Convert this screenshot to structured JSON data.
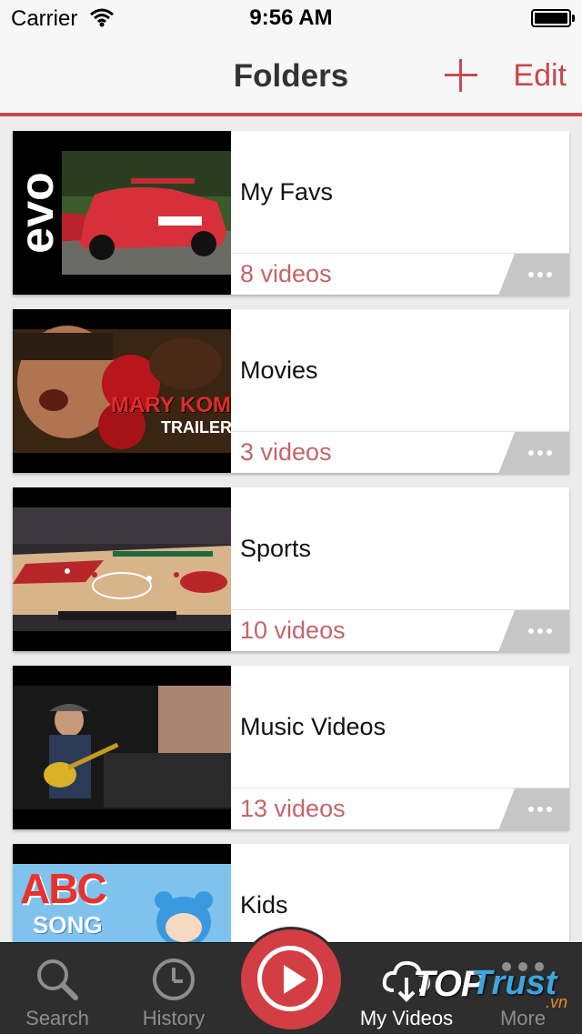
{
  "status_bar": {
    "carrier": "Carrier",
    "time": "9:56 AM"
  },
  "nav": {
    "title": "Folders",
    "edit_label": "Edit"
  },
  "folders": [
    {
      "name": "My Favs",
      "count": "8 videos",
      "thumb_text": "evo",
      "icon": "car-thumbnail"
    },
    {
      "name": "Movies",
      "count": "3 videos",
      "thumb_text": "MARY KOM",
      "thumb_subtext": "TRAILER",
      "icon": "boxer-thumbnail"
    },
    {
      "name": "Sports",
      "count": "10 videos",
      "icon": "basketball-court-thumbnail"
    },
    {
      "name": "Music Videos",
      "count": "13 videos",
      "icon": "guitarist-thumbnail"
    },
    {
      "name": "Kids",
      "count": "",
      "thumb_text": "ABC",
      "thumb_subtext": "SONG",
      "icon": "cartoon-thumbnail"
    }
  ],
  "tabs": [
    {
      "label": "Search",
      "icon": "search-icon"
    },
    {
      "label": "History",
      "icon": "clock-icon"
    },
    {
      "label": "My Videos",
      "icon": "cloud-download-icon",
      "active": true
    },
    {
      "label": "More",
      "icon": "more-dots-icon"
    }
  ],
  "watermark": {
    "top": "TOP",
    "trust": "Trust",
    "suffix": ".vn"
  },
  "colors": {
    "accent": "#c9484d",
    "count_text": "#c4656a",
    "tab_bar": "#2e2e2e",
    "play": "#d23e43"
  }
}
